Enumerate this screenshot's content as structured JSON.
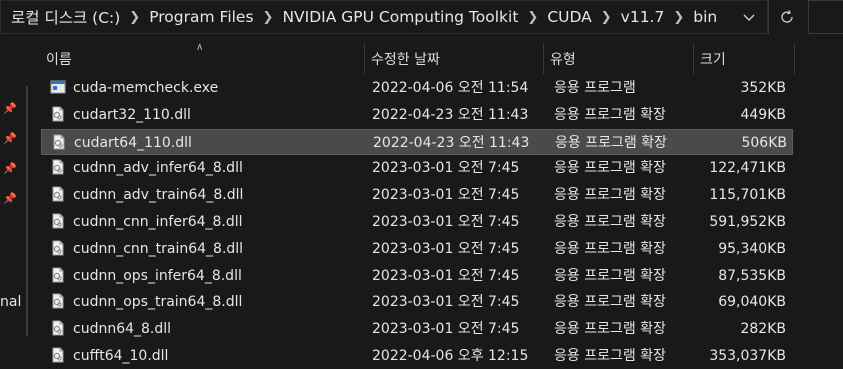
{
  "address_bar": {
    "crumbs": [
      "로컬 디스크 (C:)",
      "Program Files",
      "NVIDIA GPU Computing Toolkit",
      "CUDA",
      "v11.7",
      "bin"
    ]
  },
  "nav": {
    "partial_label": "nal"
  },
  "columns": {
    "name": "이름",
    "date": "수정한 날짜",
    "type": "유형",
    "size": "크기"
  },
  "files": [
    {
      "name": "cuda-memcheck.exe",
      "date": "2022-04-06 오전 11:54",
      "type": "응용 프로그램",
      "size": "352KB",
      "icon": "exe-icon",
      "selected": false
    },
    {
      "name": "cudart32_110.dll",
      "date": "2022-04-23 오전 11:43",
      "type": "응용 프로그램 확장",
      "size": "449KB",
      "icon": "dll-icon",
      "selected": false
    },
    {
      "name": "cudart64_110.dll",
      "date": "2022-04-23 오전 11:43",
      "type": "응용 프로그램 확장",
      "size": "506KB",
      "icon": "dll-icon",
      "selected": true
    },
    {
      "name": "cudnn_adv_infer64_8.dll",
      "date": "2023-03-01 오전 7:45",
      "type": "응용 프로그램 확장",
      "size": "122,471KB",
      "icon": "dll-icon",
      "selected": false
    },
    {
      "name": "cudnn_adv_train64_8.dll",
      "date": "2023-03-01 오전 7:45",
      "type": "응용 프로그램 확장",
      "size": "115,701KB",
      "icon": "dll-icon",
      "selected": false
    },
    {
      "name": "cudnn_cnn_infer64_8.dll",
      "date": "2023-03-01 오전 7:45",
      "type": "응용 프로그램 확장",
      "size": "591,952KB",
      "icon": "dll-icon",
      "selected": false
    },
    {
      "name": "cudnn_cnn_train64_8.dll",
      "date": "2023-03-01 오전 7:45",
      "type": "응용 프로그램 확장",
      "size": "95,340KB",
      "icon": "dll-icon",
      "selected": false
    },
    {
      "name": "cudnn_ops_infer64_8.dll",
      "date": "2023-03-01 오전 7:45",
      "type": "응용 프로그램 확장",
      "size": "87,535KB",
      "icon": "dll-icon",
      "selected": false
    },
    {
      "name": "cudnn_ops_train64_8.dll",
      "date": "2023-03-01 오전 7:45",
      "type": "응용 프로그램 확장",
      "size": "69,040KB",
      "icon": "dll-icon",
      "selected": false
    },
    {
      "name": "cudnn64_8.dll",
      "date": "2023-03-01 오전 7:45",
      "type": "응용 프로그램 확장",
      "size": "282KB",
      "icon": "dll-icon",
      "selected": false
    },
    {
      "name": "cufft64_10.dll",
      "date": "2022-04-06 오후 12:15",
      "type": "응용 프로그램 확장",
      "size": "353,037KB",
      "icon": "dll-icon",
      "selected": false
    }
  ],
  "colors": {
    "background": "#191919",
    "selected_row": "#4a4a4a",
    "text": "#e6e6e6"
  }
}
